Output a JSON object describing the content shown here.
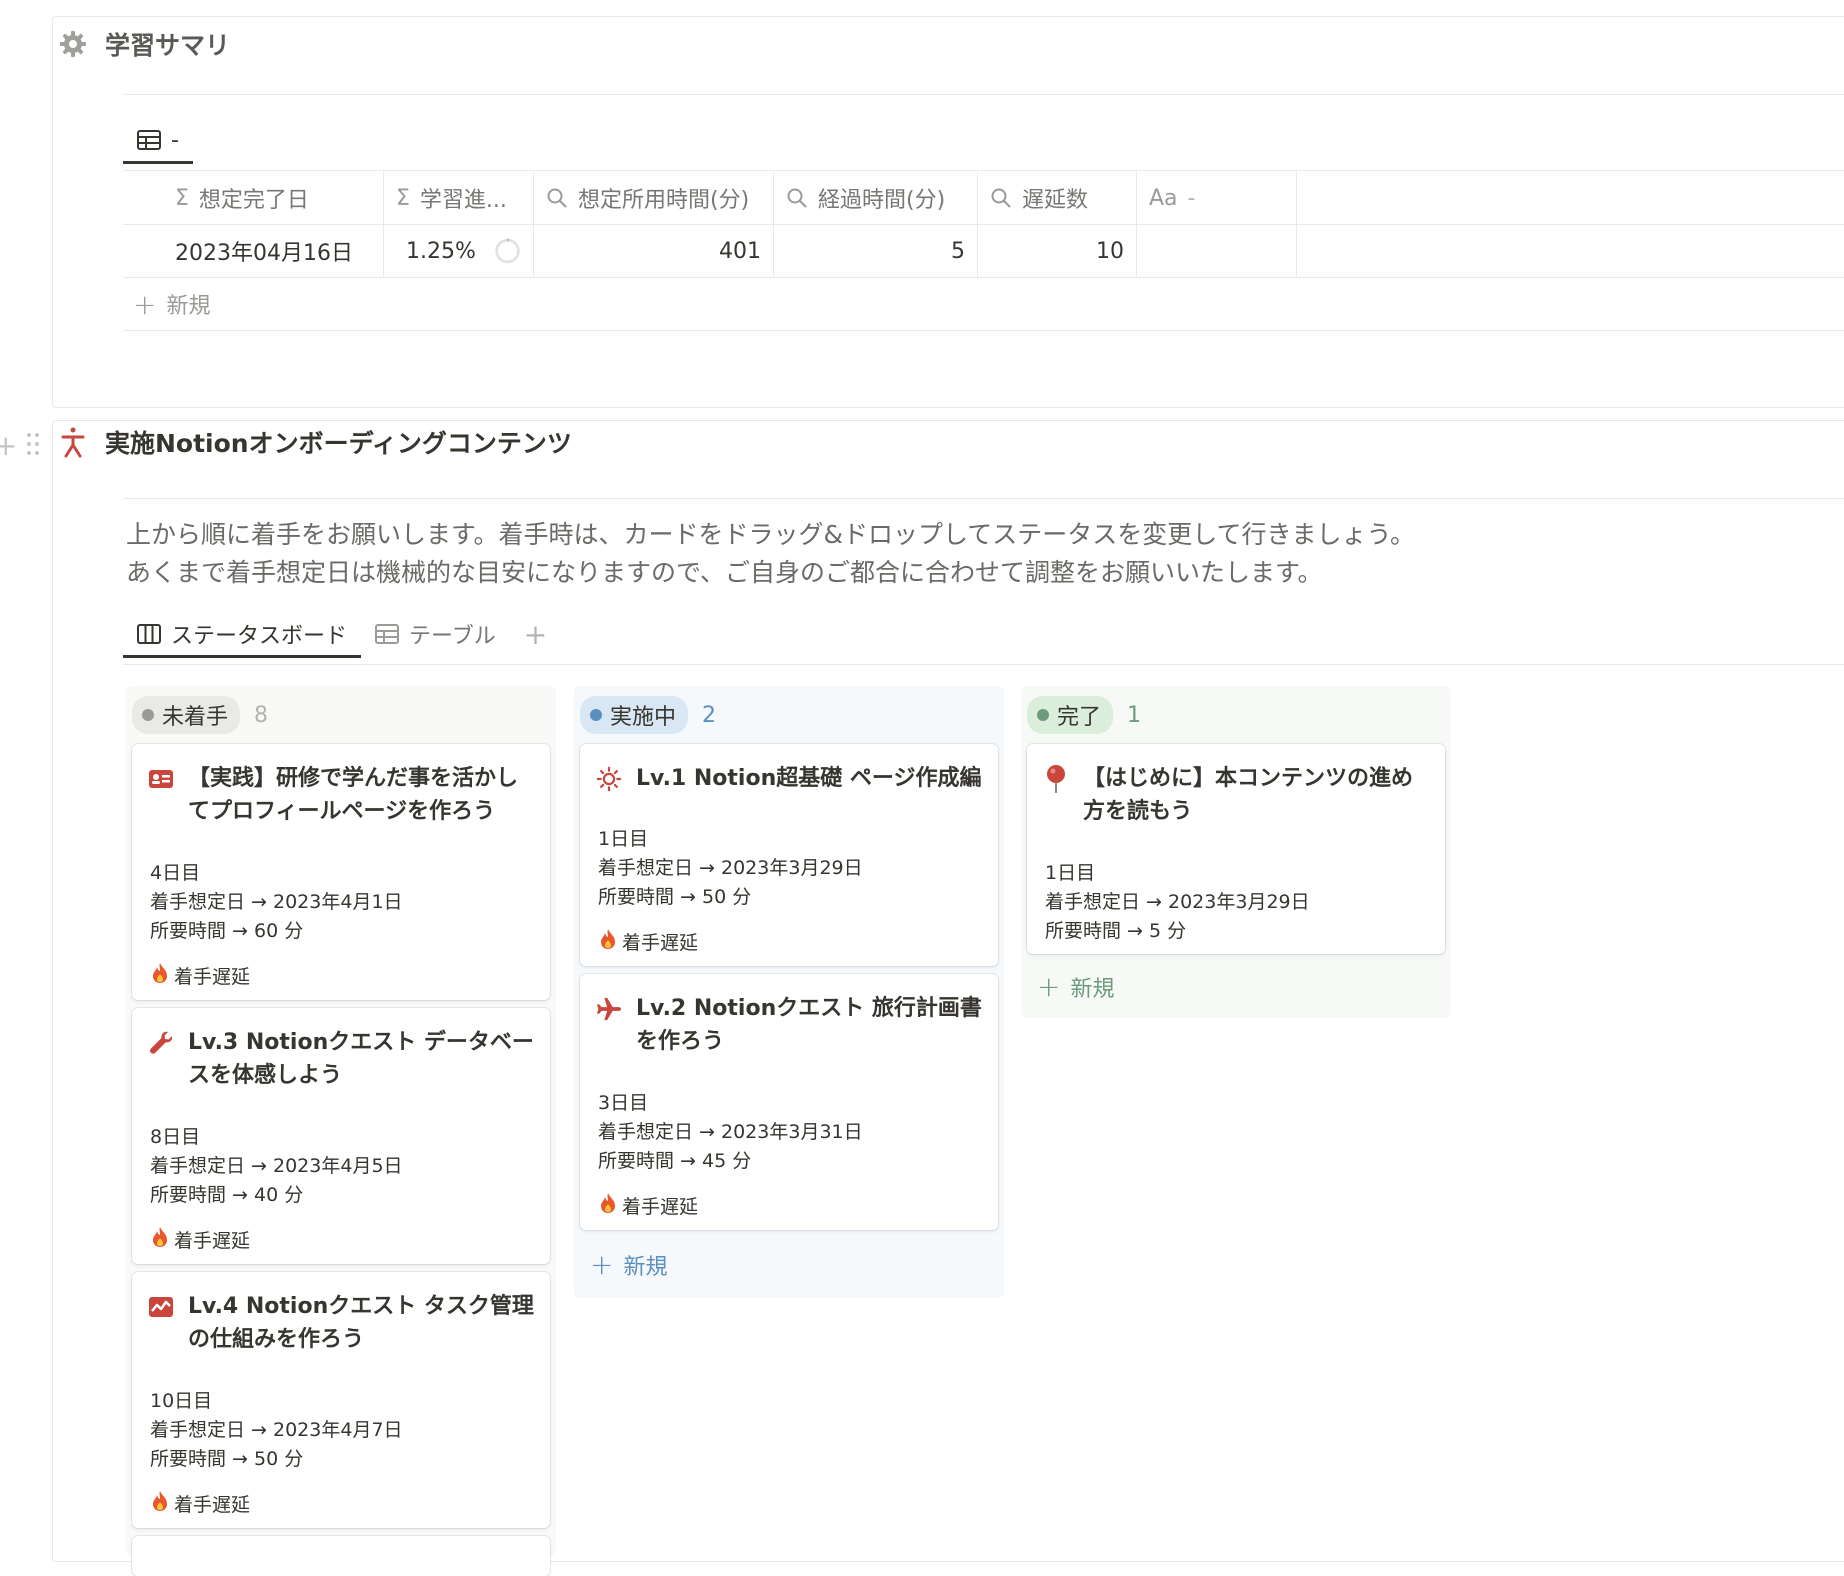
{
  "summary": {
    "title": "学習サマリ",
    "tab_label": "-",
    "columns": [
      {
        "icon": "sigma-icon",
        "label": "想定完了日"
      },
      {
        "icon": "sigma-icon",
        "label": "学習進..."
      },
      {
        "icon": "search-icon",
        "label": "想定所用時間(分)"
      },
      {
        "icon": "search-icon",
        "label": "経過時間(分)"
      },
      {
        "icon": "search-icon",
        "label": "遅延数"
      },
      {
        "icon": "text-icon",
        "label": "-"
      }
    ],
    "text_icon_label": "Aa",
    "row": {
      "completion_date": "2023年04月16日",
      "progress": "1.25%",
      "progress_value": 0.0125,
      "estimated_minutes": "401",
      "elapsed_minutes": "5",
      "delay_count": "10",
      "name": ""
    },
    "new_label": "新規"
  },
  "onboarding": {
    "title": "実施Notionオンボーディングコンテンツ",
    "description_line1": "上から順に着手をお願いします。着手時は、カードをドラッグ&ドロップしてステータスを変更して行きましょう。",
    "description_line2": "あくまで着手想定日は機械的な目安になりますので、ご自身のご都合に合わせて調整をお願いいたします。",
    "tabs": [
      {
        "label": "ステータスボード",
        "icon": "board-icon"
      },
      {
        "label": "テーブル",
        "icon": "table-icon"
      }
    ],
    "add_view_label": "+"
  },
  "board": {
    "columns": [
      {
        "status": "未着手",
        "count": "8",
        "color": "#9b9a97",
        "pill_bg": "#e9e9e7",
        "count_color": "#b4b3b0",
        "cards": [
          {
            "icon": "id-card-icon",
            "title": "【実践】研修で学んだ事を活かしてプロフィールページを作ろう",
            "day": "4日目",
            "start": "着手想定日 → 2023年4月1日",
            "duration": "所要時間 → 60 分",
            "badge": "着手遅延"
          },
          {
            "icon": "wrench-icon",
            "title": "Lv.3 Notionクエスト データベースを体感しよう",
            "day": "8日目",
            "start": "着手想定日 → 2023年4月5日",
            "duration": "所要時間 → 40 分",
            "badge": "着手遅延"
          },
          {
            "icon": "chart-icon",
            "title": "Lv.4 Notionクエスト タスク管理の仕組みを作ろう",
            "day": "10日目",
            "start": "着手想定日 → 2023年4月7日",
            "duration": "所要時間 → 50 分",
            "badge": "着手遅延"
          }
        ]
      },
      {
        "status": "実施中",
        "count": "2",
        "color": "#5b8fbf",
        "pill_bg": "#d8e7f3",
        "count_color": "#5b8fbf",
        "cards": [
          {
            "icon": "sun-icon",
            "title": "Lv.1 Notion超基礎 ページ作成編",
            "day": "1日目",
            "start": "着手想定日 → 2023年3月29日",
            "duration": "所要時間 → 50 分",
            "badge": "着手遅延"
          },
          {
            "icon": "airplane-icon",
            "title": "Lv.2 Notionクエスト 旅行計画書を作ろう",
            "day": "3日目",
            "start": "着手想定日 → 2023年3月31日",
            "duration": "所要時間 → 45 分",
            "badge": "着手遅延"
          }
        ],
        "new_label": "新規"
      },
      {
        "status": "完了",
        "count": "1",
        "color": "#6c9b7d",
        "pill_bg": "#dbeddb",
        "count_color": "#6c9b7d",
        "cards": [
          {
            "icon": "pin-icon",
            "title": "【はじめに】本コンテンツの進め方を読もう",
            "day": "1日目",
            "start": "着手想定日 → 2023年3月29日",
            "duration": "所要時間 → 5 分",
            "badge": ""
          }
        ],
        "new_label": "新規"
      }
    ]
  },
  "colors": {
    "icon_red": "#c9463d",
    "text": "#37352f",
    "muted": "#787774"
  }
}
